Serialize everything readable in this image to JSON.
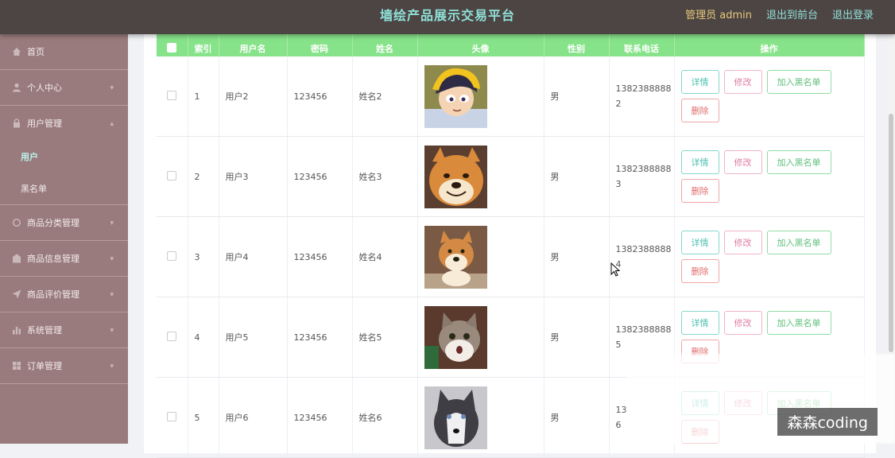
{
  "header": {
    "title": "墙绘产品展示交易平台",
    "admin": "管理员 admin",
    "front": "退出到前台",
    "logout": "退出登录"
  },
  "sidebar": {
    "items": [
      {
        "label": "首页"
      },
      {
        "label": "个人中心"
      },
      {
        "label": "用户管理",
        "sub": [
          "用户",
          "黑名单"
        ]
      },
      {
        "label": "商品分类管理"
      },
      {
        "label": "商品信息管理"
      },
      {
        "label": "商品评价管理"
      },
      {
        "label": "系统管理"
      },
      {
        "label": "订单管理"
      }
    ]
  },
  "table": {
    "headers": [
      "索引",
      "用户名",
      "密码",
      "姓名",
      "头像",
      "性别",
      "联系电话",
      "操作"
    ],
    "rows": [
      {
        "idx": "1",
        "user": "用户2",
        "pwd": "123456",
        "name": "姓名2",
        "sex": "男",
        "phone1": "1382388888",
        "phone2": "2",
        "avatar": "cartoon-boy"
      },
      {
        "idx": "2",
        "user": "用户3",
        "pwd": "123456",
        "name": "姓名3",
        "sex": "男",
        "phone1": "1382388888",
        "phone2": "3",
        "avatar": "shiba-smile"
      },
      {
        "idx": "3",
        "user": "用户4",
        "pwd": "123456",
        "name": "姓名4",
        "sex": "男",
        "phone1": "1382388888",
        "phone2": "4",
        "avatar": "shiba-sit"
      },
      {
        "idx": "4",
        "user": "用户5",
        "pwd": "123456",
        "name": "姓名5",
        "sex": "男",
        "phone1": "1382388888",
        "phone2": "5",
        "avatar": "cat-surprised"
      },
      {
        "idx": "5",
        "user": "用户6",
        "pwd": "123456",
        "name": "姓名6",
        "sex": "男",
        "phone1": "13",
        "phone2": "6",
        "avatar": "husky"
      }
    ],
    "ops": {
      "detail": "详情",
      "edit": "修改",
      "blacklist": "加入黑名单",
      "delete": "删除"
    }
  },
  "watermark": "森森coding",
  "colors": {
    "header_bg": "#4d4444",
    "sidebar_bg": "#9a7b7d",
    "table_header": "#87e38a",
    "title": "#8fe0d6"
  }
}
